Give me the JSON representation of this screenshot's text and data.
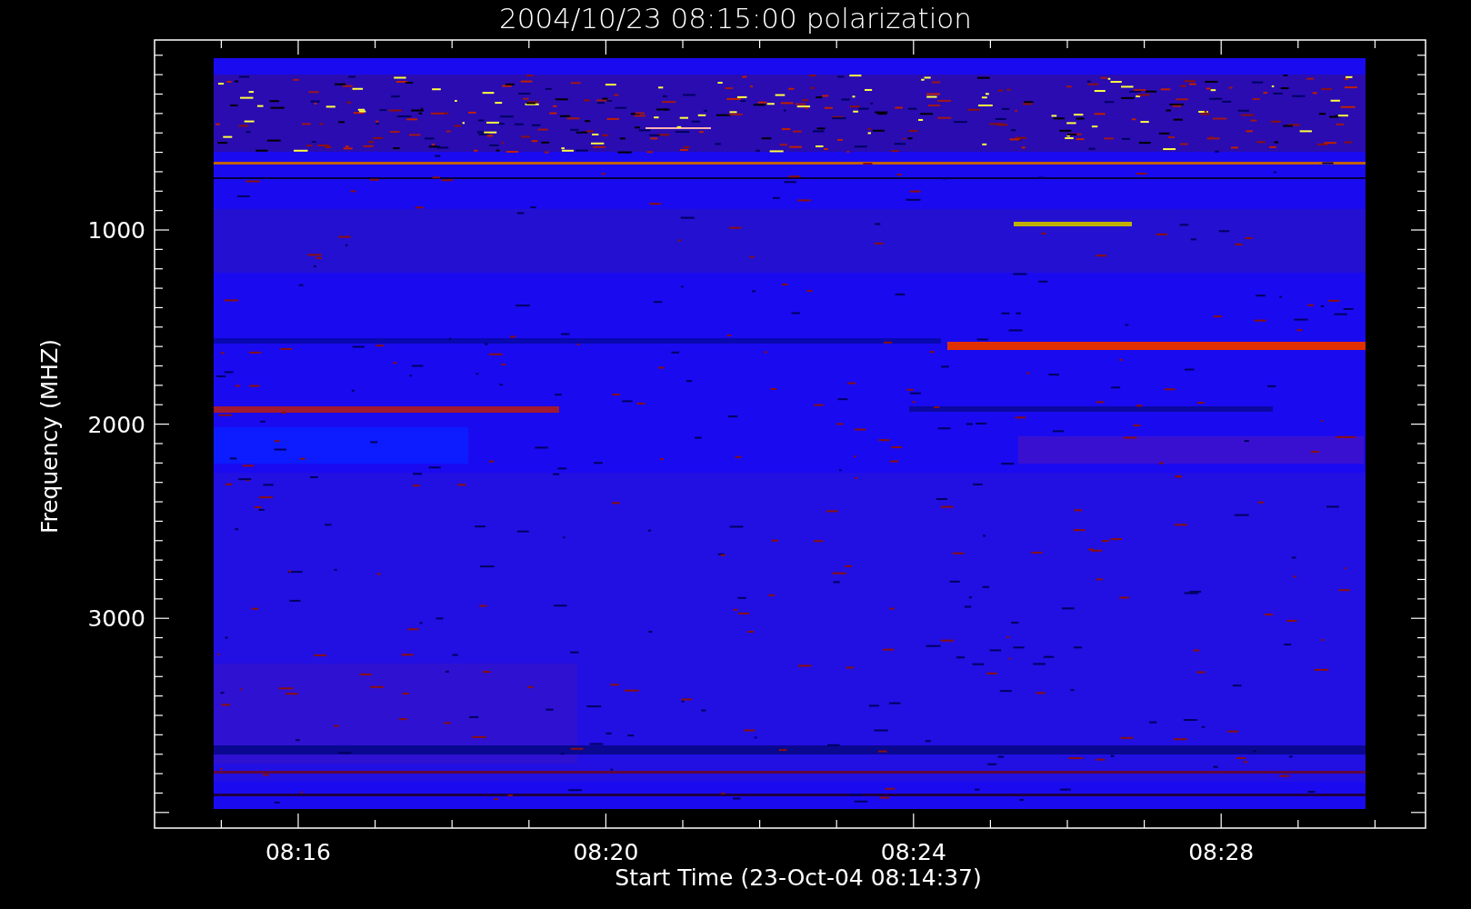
{
  "title": "2004/10/23 08:15:00 polarization",
  "y_axis": {
    "label": "Frequency (MHZ)",
    "ticks": [
      "1000",
      "2000",
      "3000"
    ]
  },
  "x_axis": {
    "label": "Start Time (23-Oct-04 08:14:37)",
    "ticks": [
      "08:16",
      "08:20",
      "08:24",
      "08:28"
    ]
  }
}
